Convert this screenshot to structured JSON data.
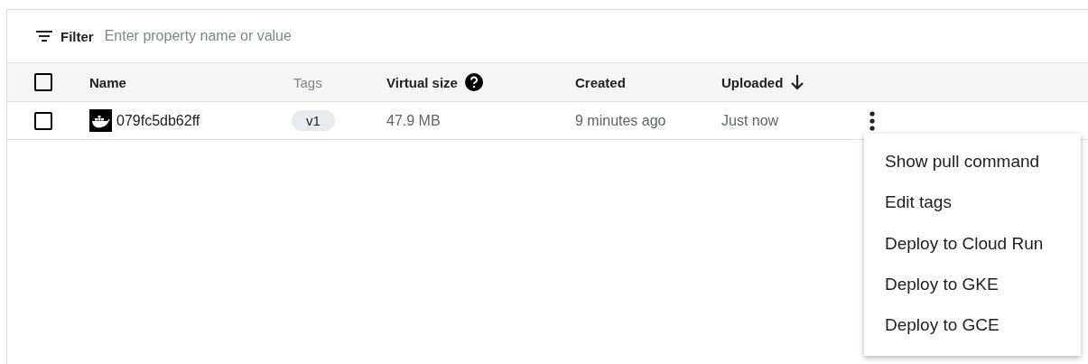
{
  "filter": {
    "label": "Filter",
    "placeholder": "Enter property name or value"
  },
  "table": {
    "select_all": {
      "checked": false
    },
    "columns": [
      {
        "label": "Name",
        "sortable": true
      },
      {
        "label": "Tags",
        "sortable": false
      },
      {
        "label": "Virtual size",
        "sortable": true,
        "help": true
      },
      {
        "label": "Created",
        "sortable": true
      },
      {
        "label": "Uploaded",
        "sortable": true,
        "sorted_descending": true
      }
    ],
    "rows": [
      {
        "checked": false,
        "name": "079fc5db62ff",
        "tags": [
          "v1"
        ],
        "virtual_size": "47.9 MB",
        "created": "9 minutes ago",
        "uploaded": "Just now"
      }
    ]
  },
  "menu": {
    "items": [
      "Show pull command",
      "Edit tags",
      "Deploy to Cloud Run",
      "Deploy to GKE",
      "Deploy to GCE"
    ]
  }
}
